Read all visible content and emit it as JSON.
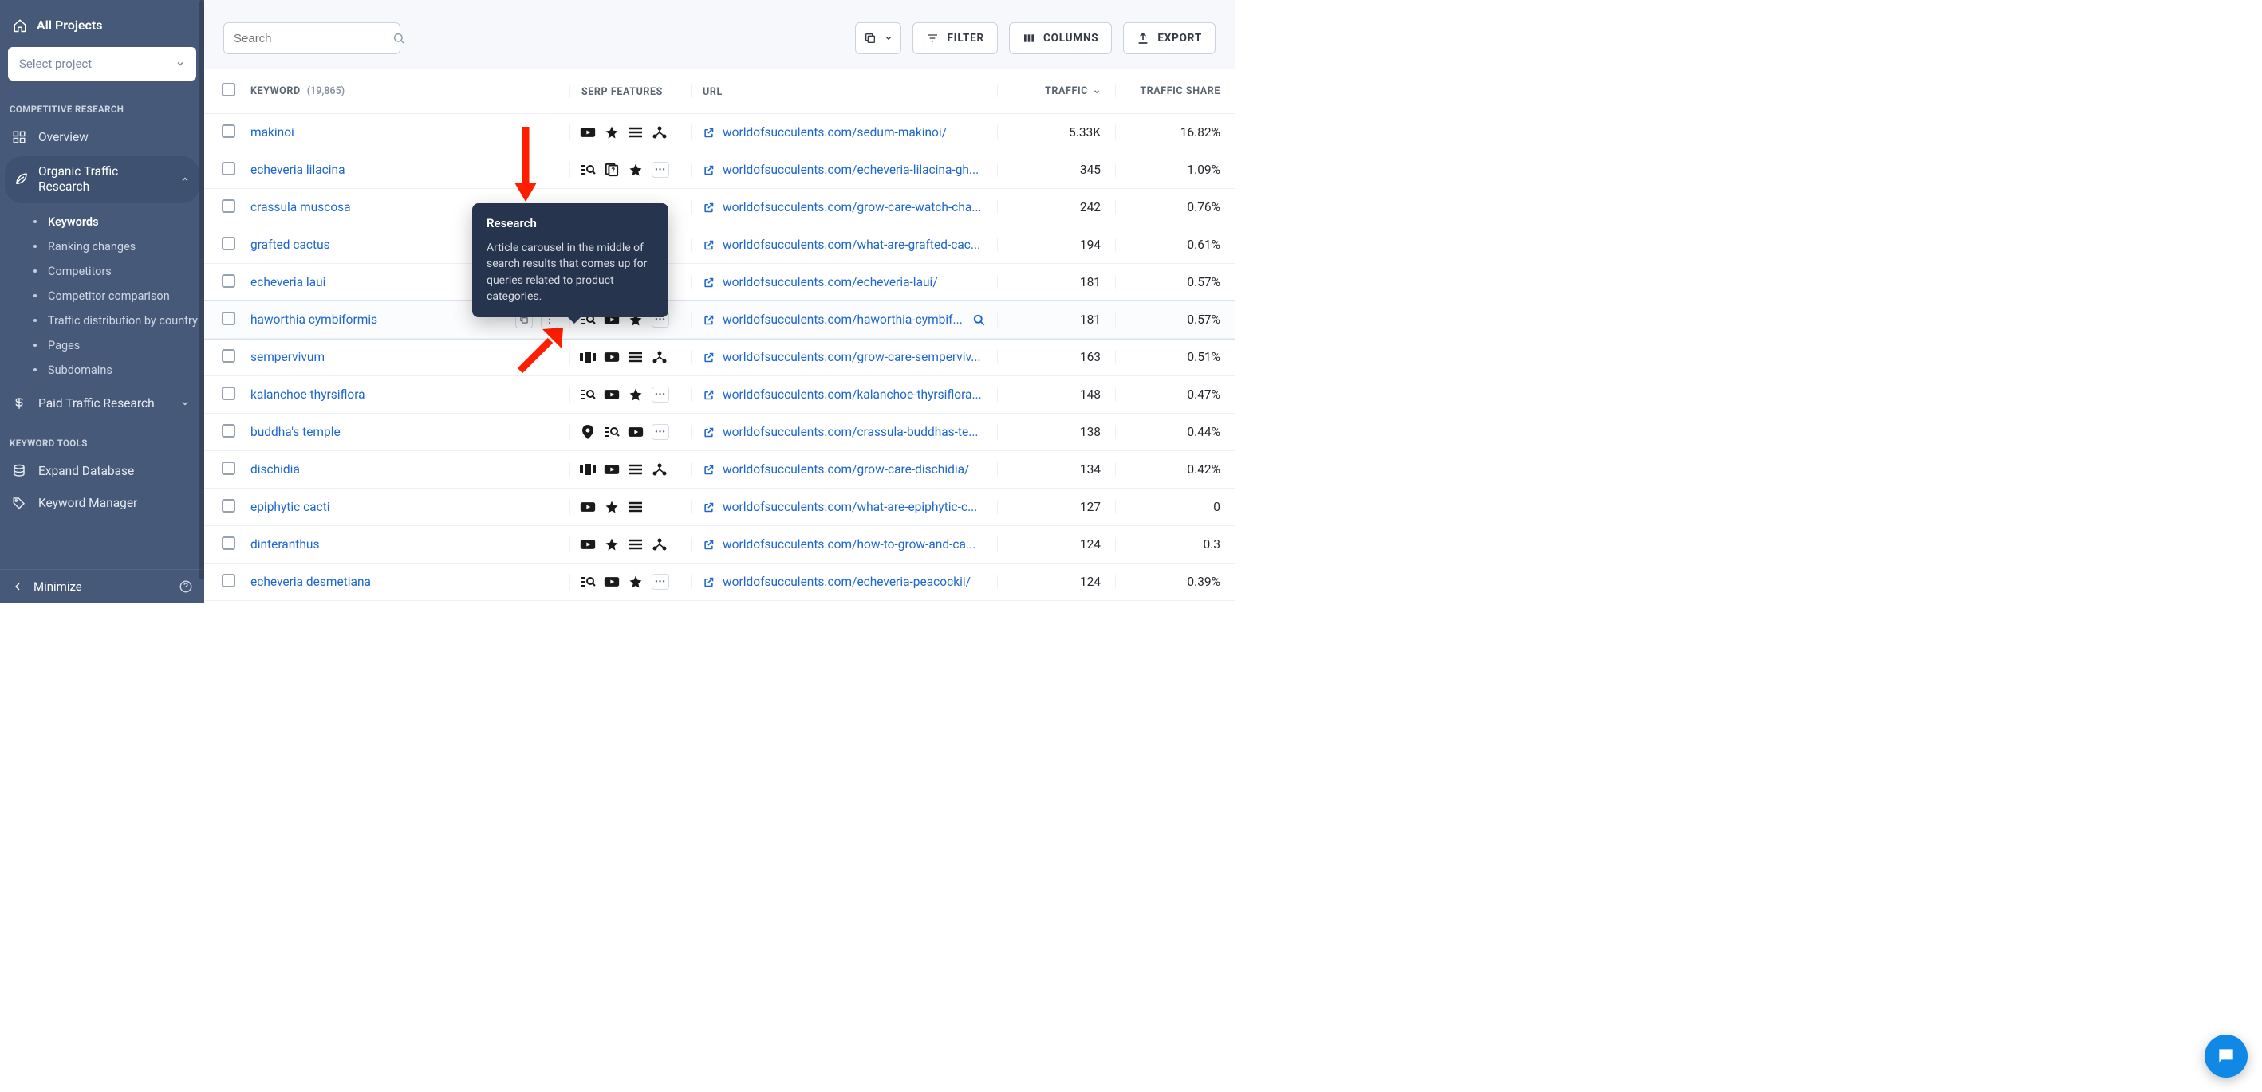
{
  "sidebar": {
    "all_projects_label": "All Projects",
    "project_select_placeholder": "Select project",
    "section_competitive": "COMPETITIVE RESEARCH",
    "nav_overview": "Overview",
    "nav_organic_traffic": "Organic Traffic Research",
    "sub_items": [
      {
        "label": "Keywords",
        "active": true
      },
      {
        "label": "Ranking changes"
      },
      {
        "label": "Competitors"
      },
      {
        "label": "Competitor comparison"
      },
      {
        "label": "Traffic distribution by country"
      },
      {
        "label": "Pages"
      },
      {
        "label": "Subdomains"
      }
    ],
    "nav_paid": "Paid Traffic Research",
    "section_keyword_tools": "KEYWORD TOOLS",
    "nav_expand_db": "Expand Database",
    "nav_keyword_manager": "Keyword Manager",
    "minimize_label": "Minimize"
  },
  "toolbar": {
    "search_placeholder": "Search",
    "filter_label": "FILTER",
    "columns_label": "COLUMNS",
    "export_label": "EXPORT"
  },
  "table": {
    "head_keyword": "KEYWORD",
    "head_keyword_count": "(19,865)",
    "head_serp": "SERP FEATURES",
    "head_url": "URL",
    "head_traffic": "TRAFFIC",
    "head_share": "TRAFFIC SHARE",
    "rows": [
      {
        "keyword": "makinoi",
        "serp": [
          "video",
          "star",
          "list",
          "sitelinks"
        ],
        "url": "worldofsucculents.com/sedum-makinoi/",
        "traffic": "5.33K",
        "share": "16.82%"
      },
      {
        "keyword": "echeveria lilacina",
        "serp": [
          "research",
          "faq",
          "star",
          "more"
        ],
        "url": "worldofsucculents.com/echeveria-lilacina-gh...",
        "traffic": "345",
        "share": "1.09%"
      },
      {
        "keyword": "crassula muscosa",
        "serp": [],
        "url": "worldofsucculents.com/grow-care-watch-cha...",
        "traffic": "242",
        "share": "0.76%"
      },
      {
        "keyword": "grafted cactus",
        "serp": [],
        "url": "worldofsucculents.com/what-are-grafted-cac...",
        "traffic": "194",
        "share": "0.61%"
      },
      {
        "keyword": "echeveria laui",
        "serp": [],
        "url": "worldofsucculents.com/echeveria-laui/",
        "traffic": "181",
        "share": "0.57%"
      },
      {
        "keyword": "haworthia cymbiformis",
        "serp": [
          "research",
          "video",
          "star",
          "more"
        ],
        "url": "worldofsucculents.com/haworthia-cymbif...",
        "traffic": "181",
        "share": "0.57%",
        "hovered": true,
        "actions": true,
        "magnify": true
      },
      {
        "keyword": "sempervivum",
        "serp": [
          "carousel",
          "video",
          "list",
          "sitelinks"
        ],
        "url": "worldofsucculents.com/grow-care-semperviv...",
        "traffic": "163",
        "share": "0.51%"
      },
      {
        "keyword": "kalanchoe thyrsiflora",
        "serp": [
          "research",
          "video",
          "star",
          "more"
        ],
        "url": "worldofsucculents.com/kalanchoe-thyrsiflora...",
        "traffic": "148",
        "share": "0.47%"
      },
      {
        "keyword": "buddha's temple",
        "serp": [
          "local",
          "research",
          "video",
          "more"
        ],
        "url": "worldofsucculents.com/crassula-buddhas-te...",
        "traffic": "138",
        "share": "0.44%"
      },
      {
        "keyword": "dischidia",
        "serp": [
          "carousel",
          "video",
          "list",
          "sitelinks"
        ],
        "url": "worldofsucculents.com/grow-care-dischidia/",
        "traffic": "134",
        "share": "0.42%"
      },
      {
        "keyword": "epiphytic cacti",
        "serp": [
          "video",
          "star",
          "list"
        ],
        "url": "worldofsucculents.com/what-are-epiphytic-c...",
        "traffic": "127",
        "share": "0"
      },
      {
        "keyword": "dinteranthus",
        "serp": [
          "video",
          "star",
          "list",
          "sitelinks"
        ],
        "url": "worldofsucculents.com/how-to-grow-and-ca...",
        "traffic": "124",
        "share": "0.3"
      },
      {
        "keyword": "echeveria desmetiana",
        "serp": [
          "research",
          "video",
          "star",
          "more"
        ],
        "url": "worldofsucculents.com/echeveria-peacockii/",
        "traffic": "124",
        "share": "0.39%"
      }
    ]
  },
  "tooltip": {
    "title": "Research",
    "body": "Article carousel in the middle of search results that comes up for queries related to product categories."
  }
}
